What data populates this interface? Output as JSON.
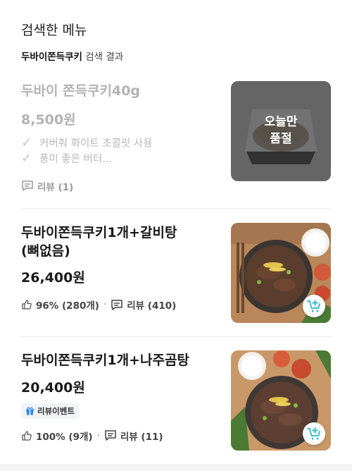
{
  "header": {
    "title": "검색한 메뉴",
    "keyword": "두바이쫀득쿠키",
    "caption_suffix": " 검색 결과"
  },
  "items": [
    {
      "name": "두바이 쫀득쿠키40g",
      "price": "8,500원",
      "descriptions": [
        "커버춰 화이트 초콜릿 사용",
        "풍미 좋은 버터..."
      ],
      "review_label": "리뷰 (1)",
      "status": "sold-out",
      "soldout_line1": "오늘만",
      "soldout_line2": "품절"
    },
    {
      "name_line1": "두바이쫀득쿠키1개+갈비탕",
      "name_line2": "(뼈없음)",
      "price": "26,400원",
      "like_label": "96% (280개)",
      "review_label": "리뷰 (410)"
    },
    {
      "name": "두바이쫀득쿠키1개+나주곰탕",
      "price": "20,400원",
      "badge": "리뷰이벤트",
      "like_label": "100% (9개)",
      "review_label": "리뷰 (11)"
    }
  ],
  "separator": "·",
  "colors": {
    "cart_accent": "#1fb5c9",
    "badge_icon": "#2d8cf0"
  },
  "icons": [
    "check-icon",
    "comment-icon",
    "thumbs-up-icon",
    "add-to-cart-icon",
    "gift-icon"
  ]
}
